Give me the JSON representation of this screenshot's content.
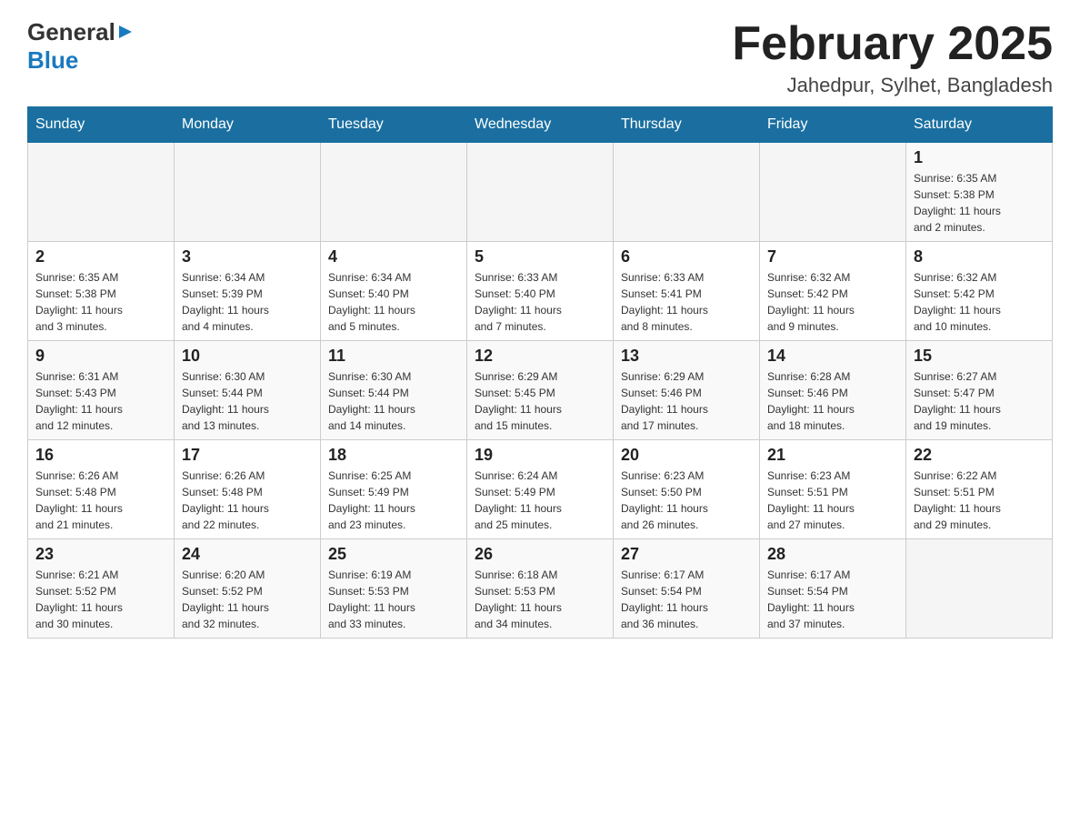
{
  "header": {
    "logo": {
      "general": "General",
      "blue": "Blue",
      "icon": "▶"
    },
    "title": "February 2025",
    "location": "Jahedpur, Sylhet, Bangladesh"
  },
  "days_of_week": [
    "Sunday",
    "Monday",
    "Tuesday",
    "Wednesday",
    "Thursday",
    "Friday",
    "Saturday"
  ],
  "weeks": [
    {
      "days": [
        {
          "number": "",
          "info": ""
        },
        {
          "number": "",
          "info": ""
        },
        {
          "number": "",
          "info": ""
        },
        {
          "number": "",
          "info": ""
        },
        {
          "number": "",
          "info": ""
        },
        {
          "number": "",
          "info": ""
        },
        {
          "number": "1",
          "info": "Sunrise: 6:35 AM\nSunset: 5:38 PM\nDaylight: 11 hours\nand 2 minutes."
        }
      ]
    },
    {
      "days": [
        {
          "number": "2",
          "info": "Sunrise: 6:35 AM\nSunset: 5:38 PM\nDaylight: 11 hours\nand 3 minutes."
        },
        {
          "number": "3",
          "info": "Sunrise: 6:34 AM\nSunset: 5:39 PM\nDaylight: 11 hours\nand 4 minutes."
        },
        {
          "number": "4",
          "info": "Sunrise: 6:34 AM\nSunset: 5:40 PM\nDaylight: 11 hours\nand 5 minutes."
        },
        {
          "number": "5",
          "info": "Sunrise: 6:33 AM\nSunset: 5:40 PM\nDaylight: 11 hours\nand 7 minutes."
        },
        {
          "number": "6",
          "info": "Sunrise: 6:33 AM\nSunset: 5:41 PM\nDaylight: 11 hours\nand 8 minutes."
        },
        {
          "number": "7",
          "info": "Sunrise: 6:32 AM\nSunset: 5:42 PM\nDaylight: 11 hours\nand 9 minutes."
        },
        {
          "number": "8",
          "info": "Sunrise: 6:32 AM\nSunset: 5:42 PM\nDaylight: 11 hours\nand 10 minutes."
        }
      ]
    },
    {
      "days": [
        {
          "number": "9",
          "info": "Sunrise: 6:31 AM\nSunset: 5:43 PM\nDaylight: 11 hours\nand 12 minutes."
        },
        {
          "number": "10",
          "info": "Sunrise: 6:30 AM\nSunset: 5:44 PM\nDaylight: 11 hours\nand 13 minutes."
        },
        {
          "number": "11",
          "info": "Sunrise: 6:30 AM\nSunset: 5:44 PM\nDaylight: 11 hours\nand 14 minutes."
        },
        {
          "number": "12",
          "info": "Sunrise: 6:29 AM\nSunset: 5:45 PM\nDaylight: 11 hours\nand 15 minutes."
        },
        {
          "number": "13",
          "info": "Sunrise: 6:29 AM\nSunset: 5:46 PM\nDaylight: 11 hours\nand 17 minutes."
        },
        {
          "number": "14",
          "info": "Sunrise: 6:28 AM\nSunset: 5:46 PM\nDaylight: 11 hours\nand 18 minutes."
        },
        {
          "number": "15",
          "info": "Sunrise: 6:27 AM\nSunset: 5:47 PM\nDaylight: 11 hours\nand 19 minutes."
        }
      ]
    },
    {
      "days": [
        {
          "number": "16",
          "info": "Sunrise: 6:26 AM\nSunset: 5:48 PM\nDaylight: 11 hours\nand 21 minutes."
        },
        {
          "number": "17",
          "info": "Sunrise: 6:26 AM\nSunset: 5:48 PM\nDaylight: 11 hours\nand 22 minutes."
        },
        {
          "number": "18",
          "info": "Sunrise: 6:25 AM\nSunset: 5:49 PM\nDaylight: 11 hours\nand 23 minutes."
        },
        {
          "number": "19",
          "info": "Sunrise: 6:24 AM\nSunset: 5:49 PM\nDaylight: 11 hours\nand 25 minutes."
        },
        {
          "number": "20",
          "info": "Sunrise: 6:23 AM\nSunset: 5:50 PM\nDaylight: 11 hours\nand 26 minutes."
        },
        {
          "number": "21",
          "info": "Sunrise: 6:23 AM\nSunset: 5:51 PM\nDaylight: 11 hours\nand 27 minutes."
        },
        {
          "number": "22",
          "info": "Sunrise: 6:22 AM\nSunset: 5:51 PM\nDaylight: 11 hours\nand 29 minutes."
        }
      ]
    },
    {
      "days": [
        {
          "number": "23",
          "info": "Sunrise: 6:21 AM\nSunset: 5:52 PM\nDaylight: 11 hours\nand 30 minutes."
        },
        {
          "number": "24",
          "info": "Sunrise: 6:20 AM\nSunset: 5:52 PM\nDaylight: 11 hours\nand 32 minutes."
        },
        {
          "number": "25",
          "info": "Sunrise: 6:19 AM\nSunset: 5:53 PM\nDaylight: 11 hours\nand 33 minutes."
        },
        {
          "number": "26",
          "info": "Sunrise: 6:18 AM\nSunset: 5:53 PM\nDaylight: 11 hours\nand 34 minutes."
        },
        {
          "number": "27",
          "info": "Sunrise: 6:17 AM\nSunset: 5:54 PM\nDaylight: 11 hours\nand 36 minutes."
        },
        {
          "number": "28",
          "info": "Sunrise: 6:17 AM\nSunset: 5:54 PM\nDaylight: 11 hours\nand 37 minutes."
        },
        {
          "number": "",
          "info": ""
        }
      ]
    }
  ]
}
